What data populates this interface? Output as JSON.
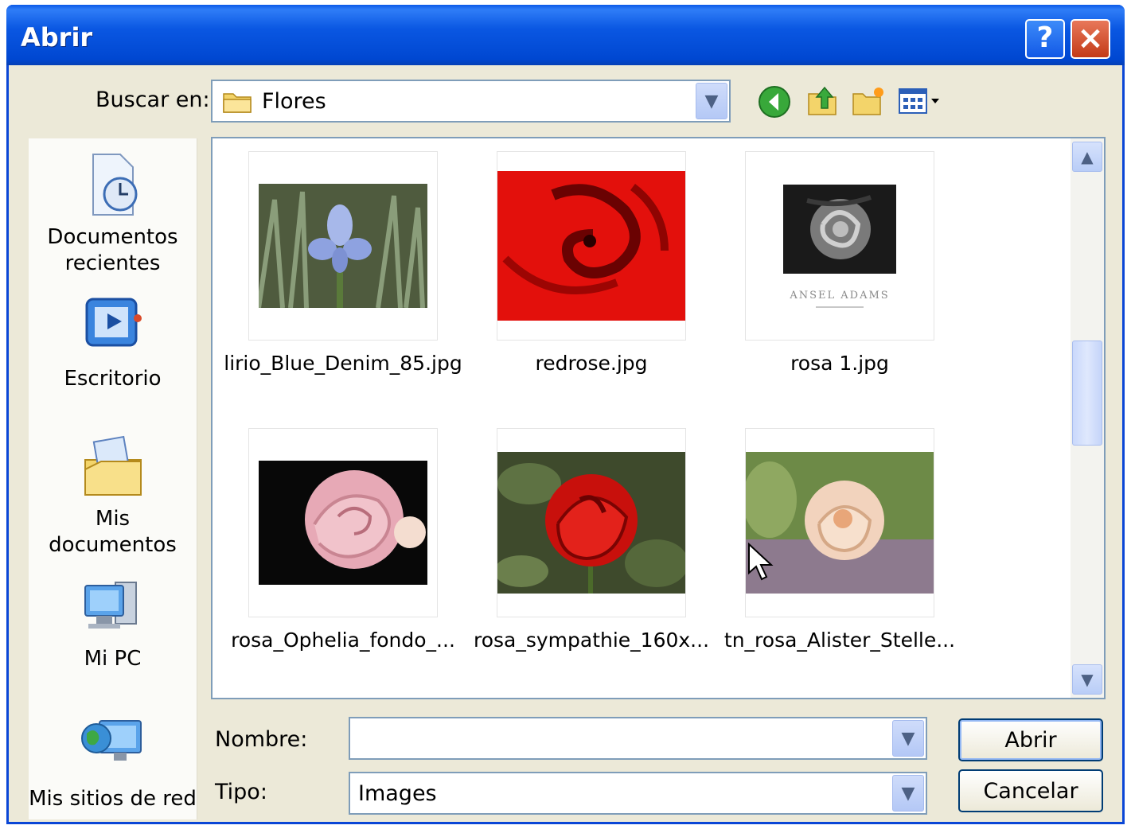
{
  "window": {
    "title": "Abrir"
  },
  "titlebar": {
    "help_label": "?",
    "close_label": "×"
  },
  "lookin": {
    "label": "Buscar en:",
    "value": "Flores"
  },
  "toolbar": {
    "icons": [
      "back-icon",
      "up-folder-icon",
      "new-folder-icon",
      "view-menu-icon"
    ]
  },
  "places": [
    {
      "label": "Documentos recientes",
      "icon": "recent-documents-icon"
    },
    {
      "label": "Escritorio",
      "icon": "desktop-icon"
    },
    {
      "label": "Mis documentos",
      "icon": "my-documents-icon"
    },
    {
      "label": "Mi PC",
      "icon": "my-computer-icon"
    },
    {
      "label": "Mis sitios de red",
      "icon": "network-places-icon"
    }
  ],
  "files": [
    {
      "name": "lirio_Blue_Denim_85.jpg"
    },
    {
      "name": "redrose.jpg"
    },
    {
      "name": "rosa 1.jpg",
      "caption": "ANSEL ADAMS"
    },
    {
      "name": "rosa_Ophelia_fondo_..."
    },
    {
      "name": "rosa_sympathie_160x..."
    },
    {
      "name": "tn_rosa_Alister_Stelle..."
    }
  ],
  "form": {
    "name_label": "Nombre:",
    "name_value": "",
    "type_label": "Tipo:",
    "type_value": "Images"
  },
  "buttons": {
    "open": "Abrir",
    "cancel": "Cancelar"
  },
  "colors": {
    "titlebar": "#0a57e2",
    "close": "#c33a17",
    "dialog": "#ece9d8"
  }
}
